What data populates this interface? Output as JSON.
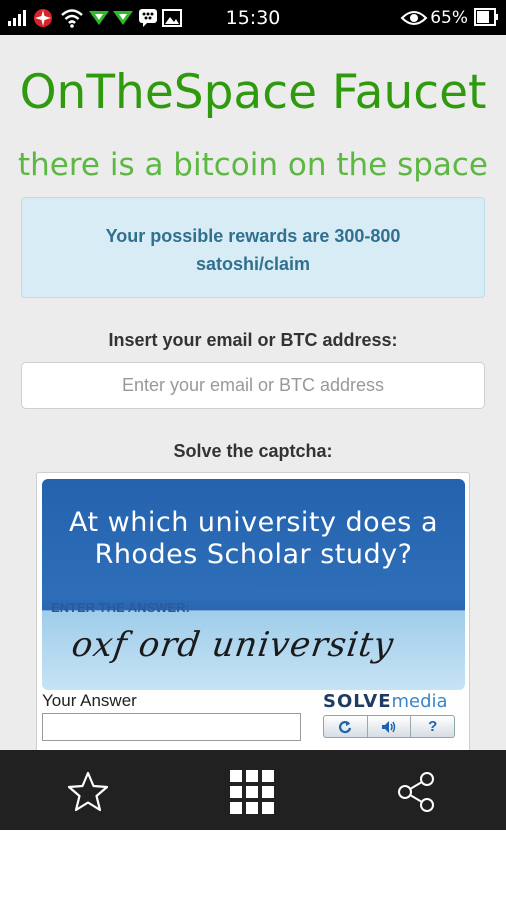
{
  "status_bar": {
    "time": "15:30",
    "battery": "65%",
    "icons": [
      "signal-icon",
      "airplane-icon",
      "wifi-icon",
      "download-icon",
      "bbm-icon",
      "image-icon",
      "eye-icon",
      "battery-icon"
    ]
  },
  "header": {
    "title": "OnTheSpace Faucet",
    "subtitle": "there is a bitcoin on the space"
  },
  "reward": {
    "line1": "Your possible rewards are 300-800",
    "line2": "satoshi/claim"
  },
  "email": {
    "label": "Insert your email or BTC address:",
    "placeholder": "Enter your email or BTC address",
    "value": ""
  },
  "captcha": {
    "label": "Solve the captcha:",
    "question_line1": "At which university does a",
    "question_line2": "Rhodes Scholar study?",
    "enter_answer": "ENTER THE ANSWER:",
    "handwritten": "oxf ord university",
    "your_answer_label": "Your Answer",
    "answer_value": "",
    "brand_solve": "SOLVE",
    "brand_media": "media",
    "buttons": [
      "refresh-icon",
      "audio-icon",
      "help-icon"
    ],
    "help_label": "?"
  },
  "bottom_nav": {
    "items": [
      "star-icon",
      "apps-grid-icon",
      "share-icon"
    ]
  },
  "colors": {
    "title_green": "#2f9a0e",
    "subtitle_green": "#5db843",
    "info_bg": "#d8ecf6",
    "info_text": "#31708f",
    "nav_bg": "#212121"
  }
}
